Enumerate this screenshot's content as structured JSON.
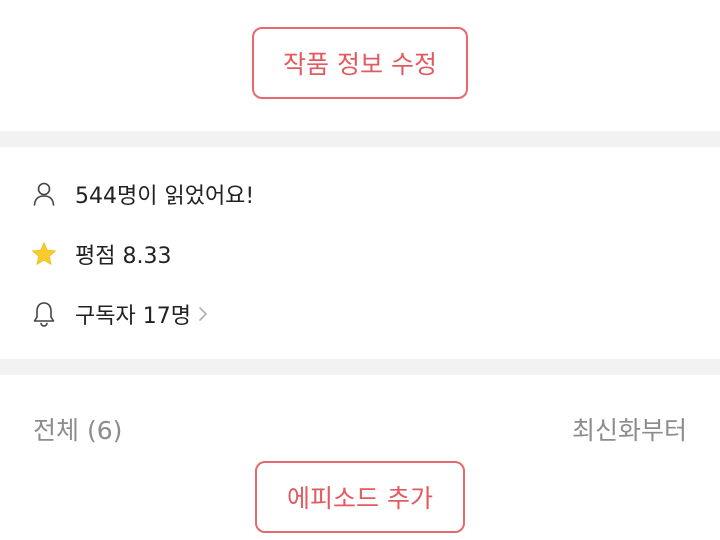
{
  "work": {
    "edit_button_label": "작품 정보 수정"
  },
  "stats": {
    "readers_text": "544명이 읽었어요!",
    "rating_text": "평점 8.33",
    "subscribers_text": "구독자 17명",
    "icons": [
      "user-icon",
      "star-icon",
      "bell-icon",
      "chevron-right-icon"
    ],
    "star_color": "#f8cc2e"
  },
  "episodes": {
    "filter_label": "전체 (6)",
    "sort_label": "최신화부터",
    "add_button_label": "에피소드 추가"
  },
  "colors": {
    "accent": "#e25a5f",
    "divider": "#f2f2f3",
    "muted_text": "#8c8c8c"
  }
}
